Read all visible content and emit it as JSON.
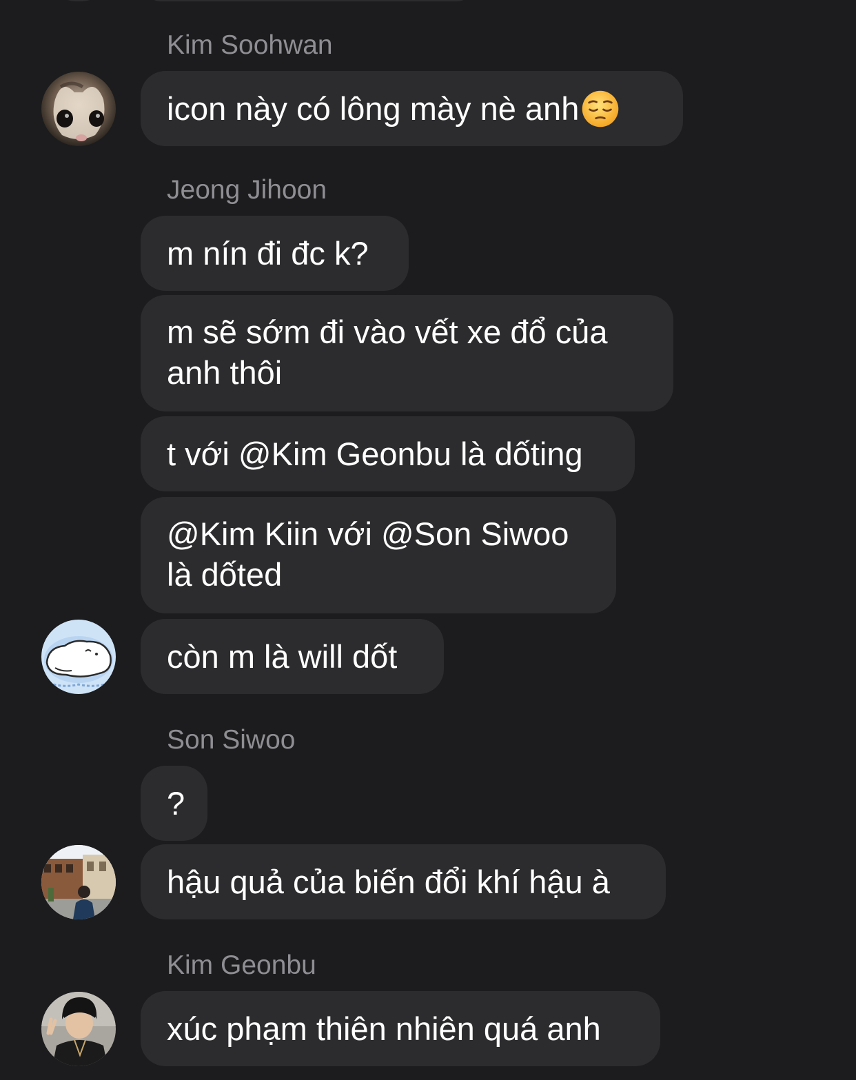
{
  "conversation": {
    "groups": [
      {
        "sender": "Kim Soohwan",
        "avatar_icon": "cat-photo-avatar",
        "messages": [
          {
            "lines": [
              "icon này có lông mày nè anh"
            ],
            "emoji": "pensive-face-emoji"
          }
        ]
      },
      {
        "sender": "Jeong Jihoon",
        "avatar_icon": "cartoon-blob-avatar",
        "messages": [
          {
            "lines": [
              "m nín đi đc k?"
            ]
          },
          {
            "lines": [
              "m sẽ sớm đi vào vết xe đổ của",
              "anh thôi"
            ]
          },
          {
            "lines": [
              "t với @Kim Geonbu là dốting"
            ]
          },
          {
            "lines": [
              "@Kim Kiin với @Son Siwoo",
              "là dốted"
            ]
          },
          {
            "lines": [
              "còn m là will dốt"
            ]
          }
        ]
      },
      {
        "sender": "Son Siwoo",
        "avatar_icon": "street-photo-avatar",
        "messages": [
          {
            "lines": [
              "?"
            ]
          },
          {
            "lines": [
              "hậu quả của biến đổi khí hậu à"
            ]
          }
        ]
      },
      {
        "sender": "Kim Geonbu",
        "avatar_icon": "person-photo-avatar",
        "messages": [
          {
            "lines": [
              "xúc phạm thiên nhiên quá anh"
            ]
          }
        ]
      }
    ]
  },
  "colors": {
    "background": "#1c1c1e",
    "bubble": "#2c2c2e",
    "sender_name": "#8e8e93",
    "text": "#ffffff"
  }
}
